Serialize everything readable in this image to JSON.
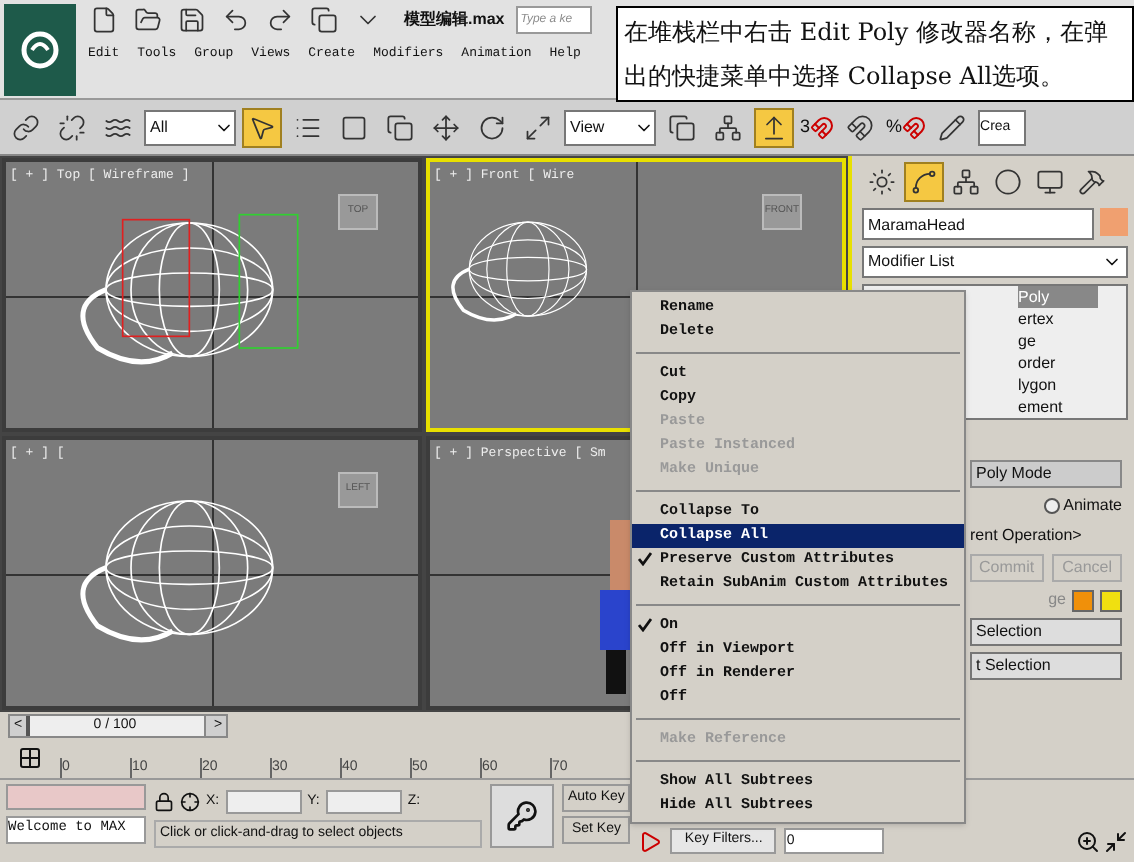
{
  "title_bar": {
    "file_title": "模型编辑.max",
    "search_placeholder": "Type a ke"
  },
  "menu": [
    {
      "label": "Edit"
    },
    {
      "label": "Tools"
    },
    {
      "label": "Group"
    },
    {
      "label": "Views"
    },
    {
      "label": "Create"
    },
    {
      "label": "Modifiers"
    },
    {
      "label": "Animation"
    },
    {
      "label": "Help"
    }
  ],
  "callout": "在堆栈栏中右击 Edit Poly 修改器名称，在弹出的快捷菜单中选择 Collapse All选项。",
  "toolbar": {
    "selection_filter": "All",
    "reference_coord": "View",
    "snap_label": "3",
    "percent_label": "%",
    "named_selection": "Crea"
  },
  "viewports": [
    {
      "label": "[ + ] Top [ Wireframe ]",
      "active": false,
      "cube": "TOP"
    },
    {
      "label": "[ + ] Front [ Wire",
      "active": true,
      "cube": "FRONT"
    },
    {
      "label": "[ + ] [",
      "active": false,
      "cube": "LEFT"
    },
    {
      "label": "[ + ] Perspective [ Sm",
      "active": false
    }
  ],
  "command_panel": {
    "object_name": "MaramaHead",
    "modifier_list": "Modifier List",
    "stack": [
      {
        "label": "Poly",
        "selected": true
      },
      {
        "label": "ertex",
        "selected": false
      },
      {
        "label": "ge",
        "selected": false
      },
      {
        "label": "order",
        "selected": false
      },
      {
        "label": "lygon",
        "selected": false
      },
      {
        "label": "ement",
        "selected": false
      }
    ],
    "rollout_title": "Poly Mode",
    "animate": {
      "label": "Animate",
      "checked": false
    },
    "operation": "rent Operation>",
    "commit": "Commit",
    "cancel": "Cancel",
    "swatch_label": "ge",
    "buttons": [
      "Selection",
      "t Selection"
    ]
  },
  "context_menu": [
    {
      "kind": "item",
      "label": "Rename",
      "disabled": false,
      "checked": false,
      "selected": false
    },
    {
      "kind": "item",
      "label": "Delete",
      "disabled": false,
      "checked": false,
      "selected": false
    },
    {
      "kind": "separator"
    },
    {
      "kind": "item",
      "label": "Cut",
      "disabled": false,
      "checked": false,
      "selected": false
    },
    {
      "kind": "item",
      "label": "Copy",
      "disabled": false,
      "checked": false,
      "selected": false
    },
    {
      "kind": "item",
      "label": "Paste",
      "disabled": true,
      "checked": false,
      "selected": false
    },
    {
      "kind": "item",
      "label": "Paste Instanced",
      "disabled": true,
      "checked": false,
      "selected": false
    },
    {
      "kind": "item",
      "label": "Make Unique",
      "disabled": true,
      "checked": false,
      "selected": false
    },
    {
      "kind": "separator"
    },
    {
      "kind": "item",
      "label": "Collapse To",
      "disabled": false,
      "checked": false,
      "selected": false
    },
    {
      "kind": "item",
      "label": "Collapse All",
      "disabled": false,
      "checked": false,
      "selected": true
    },
    {
      "kind": "item",
      "label": "Preserve Custom Attributes",
      "disabled": false,
      "checked": true,
      "selected": false
    },
    {
      "kind": "item",
      "label": "Retain SubAnim Custom Attributes",
      "disabled": false,
      "checked": false,
      "selected": false
    },
    {
      "kind": "separator"
    },
    {
      "kind": "item",
      "label": "On",
      "disabled": false,
      "checked": true,
      "selected": false
    },
    {
      "kind": "item",
      "label": "Off in Viewport",
      "disabled": false,
      "checked": false,
      "selected": false
    },
    {
      "kind": "item",
      "label": "Off in Renderer",
      "disabled": false,
      "checked": false,
      "selected": false
    },
    {
      "kind": "item",
      "label": "Off",
      "disabled": false,
      "checked": false,
      "selected": false
    },
    {
      "kind": "separator"
    },
    {
      "kind": "item",
      "label": "Make Reference",
      "disabled": true,
      "checked": false,
      "selected": false
    },
    {
      "kind": "separator"
    },
    {
      "kind": "item",
      "label": "Show All Subtrees",
      "disabled": false,
      "checked": false,
      "selected": false
    },
    {
      "kind": "item",
      "label": "Hide All Subtrees",
      "disabled": false,
      "checked": false,
      "selected": false
    }
  ],
  "timeline": {
    "position": "0 / 100",
    "level": 0,
    "prev": "<",
    "next": ">",
    "ticks": [
      "0",
      "10",
      "20",
      "30",
      "40",
      "50",
      "60",
      "70"
    ]
  },
  "status_bar": {
    "welcome": "Welcome to MAX",
    "x_label": "X:",
    "y_label": "Y:",
    "z_label": "Z:",
    "prompt": "Click or click-and-drag to select objects",
    "auto_key": "Auto Key",
    "set_key": "Set Key",
    "key_filters": "Key Filters...",
    "frame": "0"
  }
}
